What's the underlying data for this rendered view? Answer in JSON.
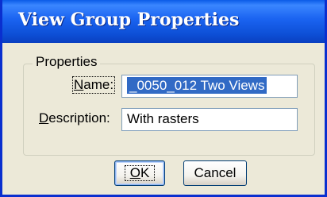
{
  "dialog": {
    "title": "View Group Properties"
  },
  "properties_group": {
    "legend": "Properties",
    "name_label_mnemonic": "N",
    "name_label_rest": "ame:",
    "name_value": "_0050_012 Two Views",
    "description_label_mnemonic": "D",
    "description_label_rest": "escription:",
    "description_value": "With rasters"
  },
  "buttons": {
    "ok_mnemonic": "O",
    "ok_rest": "K",
    "cancel_label": "Cancel"
  },
  "colors": {
    "titlebar": "#0d4fd6",
    "window_bg": "#ece9d8",
    "selection": "#316ac5"
  }
}
